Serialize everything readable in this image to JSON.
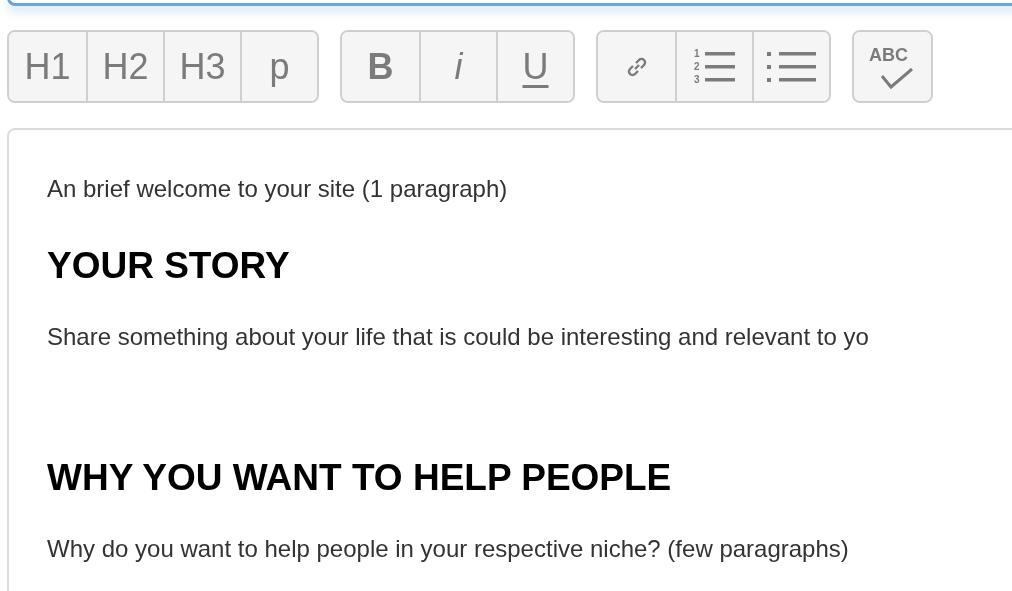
{
  "toolbar": {
    "groups": [
      {
        "buttons": [
          {
            "kind": "text",
            "label": "H1"
          },
          {
            "kind": "text",
            "label": "H2"
          },
          {
            "kind": "text",
            "label": "H3"
          },
          {
            "kind": "text",
            "label": "p"
          }
        ]
      },
      {
        "buttons": [
          {
            "kind": "bold",
            "label": "B"
          },
          {
            "kind": "italic",
            "label": "i"
          },
          {
            "kind": "underline",
            "label": "U"
          }
        ]
      },
      {
        "buttons": [
          {
            "kind": "link"
          },
          {
            "kind": "ordered_list",
            "numbers": [
              "1",
              "2",
              "3"
            ]
          },
          {
            "kind": "bullet_list"
          }
        ]
      },
      {
        "buttons": [
          {
            "kind": "spellcheck",
            "label": "ABC"
          }
        ]
      }
    ]
  },
  "editor": {
    "blocks": [
      {
        "kind": "paragraph",
        "text": "An brief welcome to your site (1 paragraph)"
      },
      {
        "kind": "heading",
        "text": "YOUR STORY"
      },
      {
        "kind": "paragraph",
        "text": "Share something about your life that is could be interesting and relevant to yo"
      },
      {
        "kind": "blank_line"
      },
      {
        "kind": "heading",
        "text": "WHY YOU WANT TO HELP PEOPLE"
      },
      {
        "kind": "paragraph",
        "text": "Why do you want to help people in your respective niche? (few paragraphs)"
      }
    ]
  }
}
